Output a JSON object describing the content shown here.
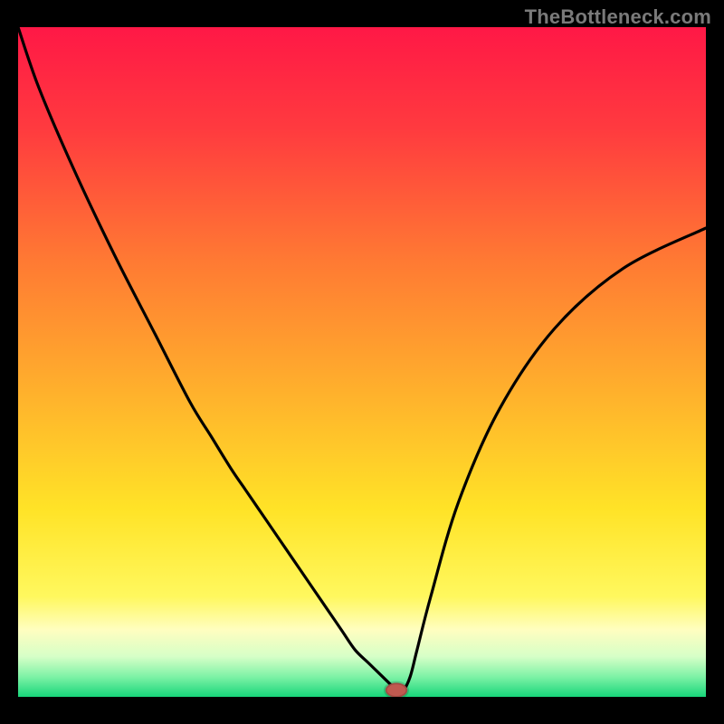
{
  "watermark": "TheBottleneck.com",
  "chart_data": {
    "type": "line",
    "title": "",
    "xlabel": "",
    "ylabel": "",
    "xlim": [
      0,
      100
    ],
    "ylim": [
      0,
      100
    ],
    "grid": false,
    "legend": false,
    "series": [
      {
        "name": "bottleneck-curve",
        "x": [
          0,
          3,
          8,
          14,
          20,
          25,
          28,
          31,
          33,
          35,
          37,
          39,
          41,
          43,
          45,
          47,
          49,
          51,
          53,
          54,
          55,
          56,
          57,
          58,
          60,
          64,
          70,
          78,
          88,
          100
        ],
        "y": [
          100,
          91,
          79,
          66,
          54,
          44,
          39,
          34,
          31,
          28,
          25,
          22,
          19,
          16,
          13,
          10,
          7,
          5,
          3,
          2,
          1,
          1,
          3,
          7,
          15,
          29,
          43,
          55,
          64,
          70
        ]
      }
    ],
    "marker": {
      "x": 55,
      "y": 1,
      "color": "#c05a50"
    },
    "gradient_stops": [
      {
        "offset": 0,
        "color": "#ff1846"
      },
      {
        "offset": 0.15,
        "color": "#ff3a3f"
      },
      {
        "offset": 0.35,
        "color": "#ff7a33"
      },
      {
        "offset": 0.55,
        "color": "#ffb22c"
      },
      {
        "offset": 0.72,
        "color": "#ffe327"
      },
      {
        "offset": 0.85,
        "color": "#fff85e"
      },
      {
        "offset": 0.9,
        "color": "#fffec0"
      },
      {
        "offset": 0.94,
        "color": "#d6ffc7"
      },
      {
        "offset": 0.97,
        "color": "#7ef2a6"
      },
      {
        "offset": 1.0,
        "color": "#18d67a"
      }
    ]
  }
}
